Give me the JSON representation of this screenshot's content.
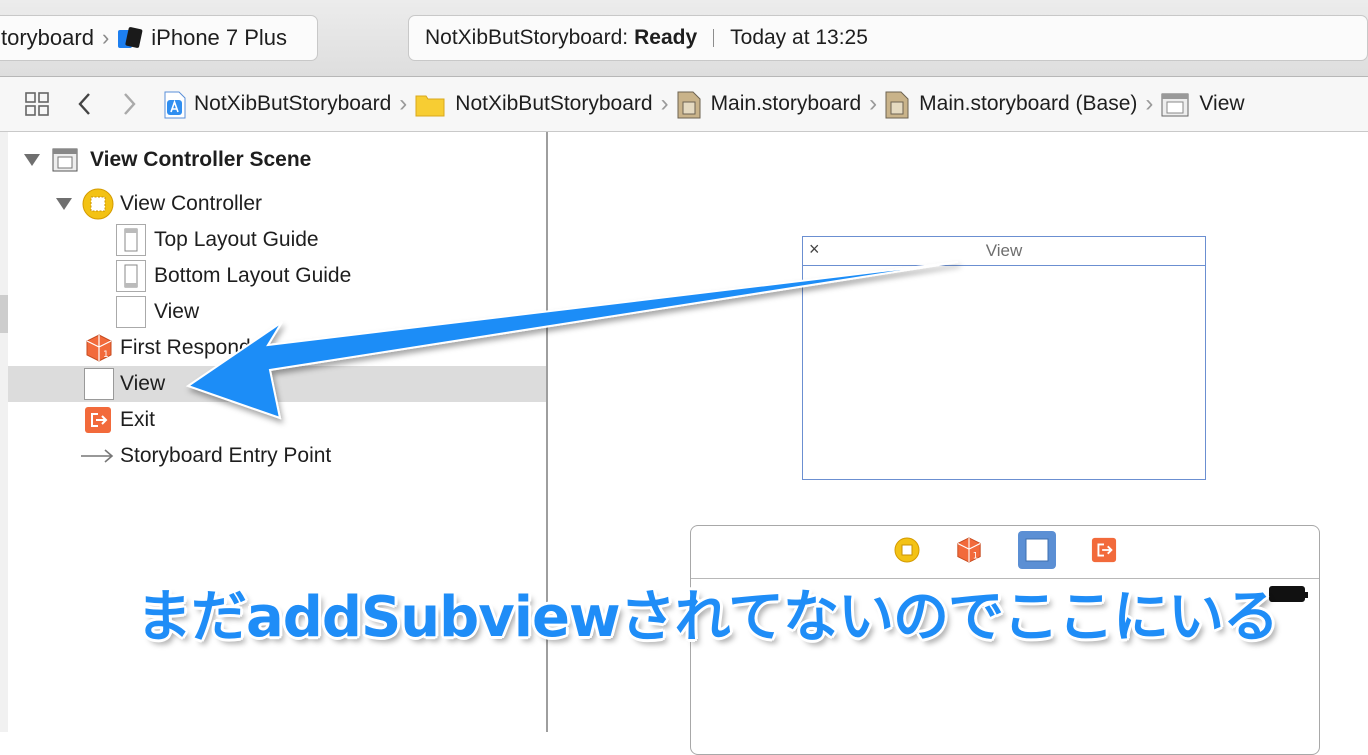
{
  "toolbar": {
    "scheme_project": "toryboard",
    "scheme_device": "iPhone 7 Plus",
    "activity_project": "NotXibButStoryboard:",
    "activity_status": "Ready",
    "activity_time": "Today at 13:25"
  },
  "jumpbar": {
    "items": [
      "NotXibButStoryboard",
      "NotXibButStoryboard",
      "Main.storyboard",
      "Main.storyboard (Base)",
      "View"
    ]
  },
  "outline": {
    "scene": "View Controller Scene",
    "items": [
      "View Controller",
      "Top Layout Guide",
      "Bottom Layout Guide",
      "View",
      "First Responder",
      "View",
      "Exit",
      "Storyboard Entry Point"
    ]
  },
  "canvas": {
    "view_title": "View",
    "close_glyph": "×"
  },
  "annotation": {
    "caption": "まだaddSubviewされてないのでここにいる"
  },
  "colors": {
    "accent_blue": "#1f8df7",
    "selection": "#dcdcdc"
  }
}
